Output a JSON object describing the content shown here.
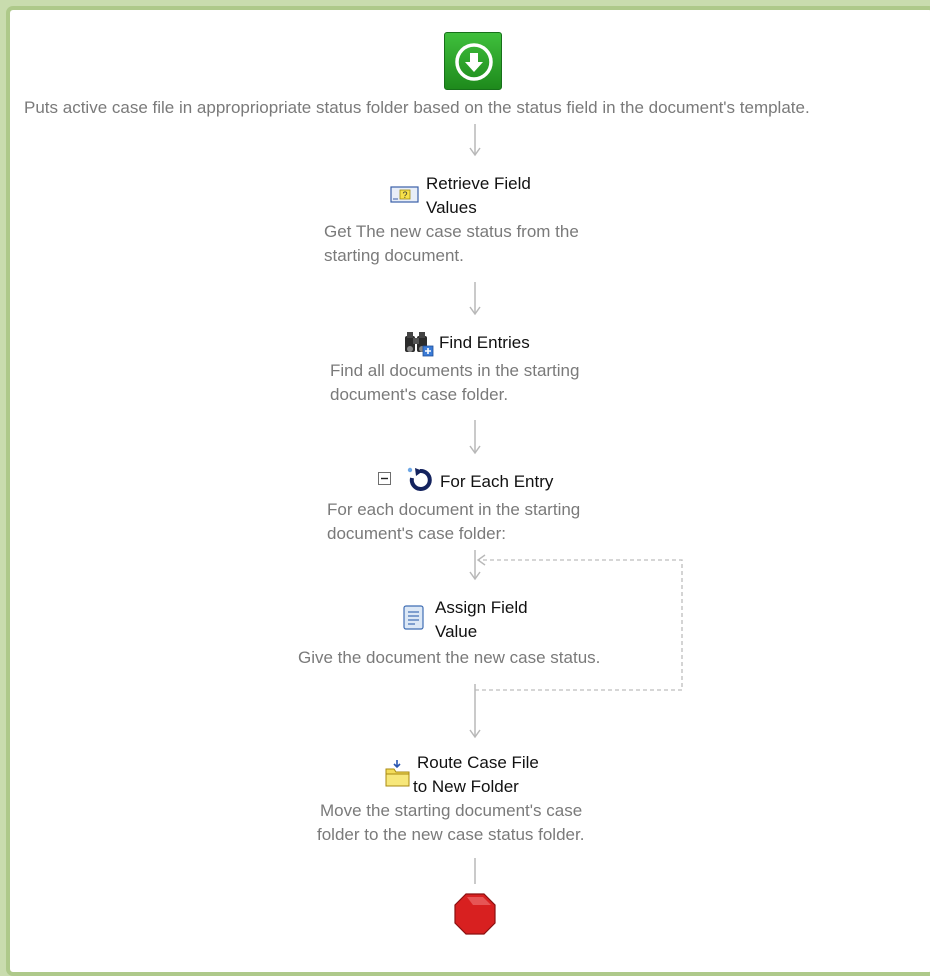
{
  "workflow": {
    "start_description": "Puts active case file in appropriopriate status folder based on the status field in the document's template.",
    "steps": [
      {
        "title_line1": "Retrieve Field",
        "title_line2": "Values",
        "desc_line1": "Get The new case status from the",
        "desc_line2": "starting document.",
        "icon": "field-values-icon"
      },
      {
        "title_line1": "Find Entries",
        "desc_line1": "Find all documents in the starting",
        "desc_line2": "document's case folder.",
        "icon": "binoculars-icon"
      },
      {
        "title_line1": "For Each Entry",
        "desc_line1": "For each document in the starting",
        "desc_line2": "document's case folder:",
        "icon": "loop-icon",
        "collapse_icon": "collapse-minus-icon"
      },
      {
        "title_line1": "Assign Field",
        "title_line2": "Value",
        "desc_line1": "Give the document the new case status.",
        "icon": "assign-field-icon"
      },
      {
        "title_line1": "Route Case File",
        "title_line2": "to New Folder",
        "desc_line1": "Move the starting document's case",
        "desc_line2": "folder to the new case status folder.",
        "icon": "route-folder-icon"
      }
    ],
    "start_icon": "start-arrow-icon",
    "end_icon": "stop-octagon-icon"
  },
  "colors": {
    "frame_border": "#aec98a",
    "frame_background": "#c9dcae",
    "start_green": "#2aa52a",
    "stop_red": "#d82020",
    "connector": "#b8b8b8",
    "description_text": "#7a7a7a"
  }
}
